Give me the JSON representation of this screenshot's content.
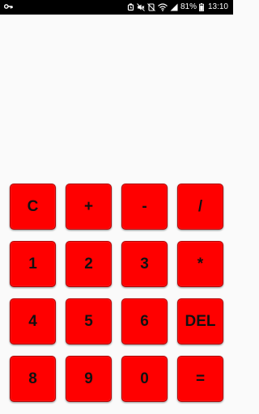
{
  "status_bar": {
    "battery": "81%",
    "time": "13:10",
    "icons": [
      "key-icon",
      "alarm-icon",
      "mute-icon",
      "silent-icon",
      "wifi-icon",
      "signal-icon",
      "battery-icon"
    ]
  },
  "keypad": {
    "rows": [
      [
        "C",
        "+",
        "-",
        "/"
      ],
      [
        "1",
        "2",
        "3",
        "*"
      ],
      [
        "4",
        "5",
        "6",
        "DEL"
      ],
      [
        "8",
        "9",
        "0",
        "="
      ]
    ]
  },
  "colors": {
    "key_fill": "#ff0000",
    "key_text": "#111111",
    "background": "#fafafa",
    "status_bar": "#000000"
  }
}
